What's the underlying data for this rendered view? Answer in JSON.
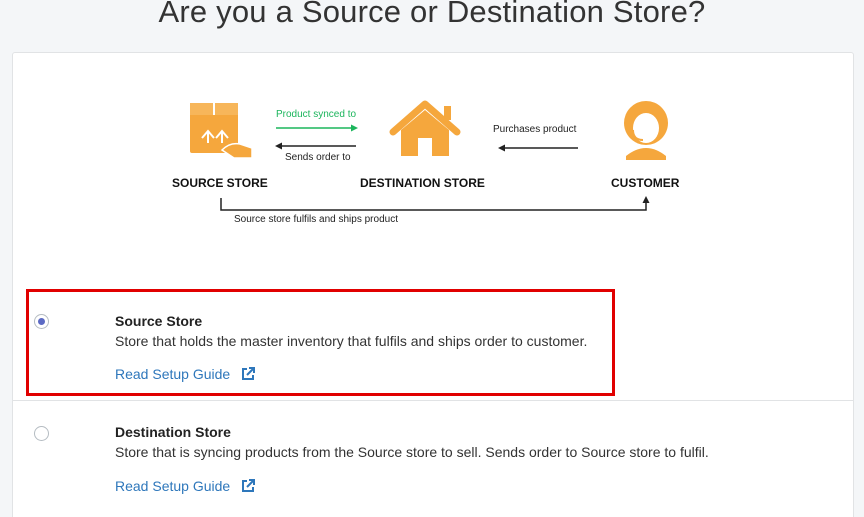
{
  "page": {
    "title": "Are you a Source or Destination Store?"
  },
  "diagram": {
    "source_label": "SOURCE STORE",
    "destination_label": "DESTINATION STORE",
    "customer_label": "CUSTOMER",
    "synced_text": "Product synced to",
    "sends_text": "Sends order to",
    "purchases_text": "Purchases product",
    "fulfils_text": "Source store fulfils and ships product",
    "icon_color": "#f5a73d",
    "synced_color": "#1bb55c"
  },
  "options": [
    {
      "title": "Source Store",
      "description": "Store that holds the master inventory that fulfils and ships order to customer.",
      "guide_label": "Read Setup Guide",
      "selected": true
    },
    {
      "title": "Destination Store",
      "description": "Store that is syncing products from the Source store to sell. Sends order to Source store to fulfil.",
      "guide_label": "Read Setup Guide",
      "selected": false
    }
  ],
  "colors": {
    "link": "#2e77bb",
    "highlight_border": "#e10000",
    "radio_selected": "#5c6ac4"
  }
}
